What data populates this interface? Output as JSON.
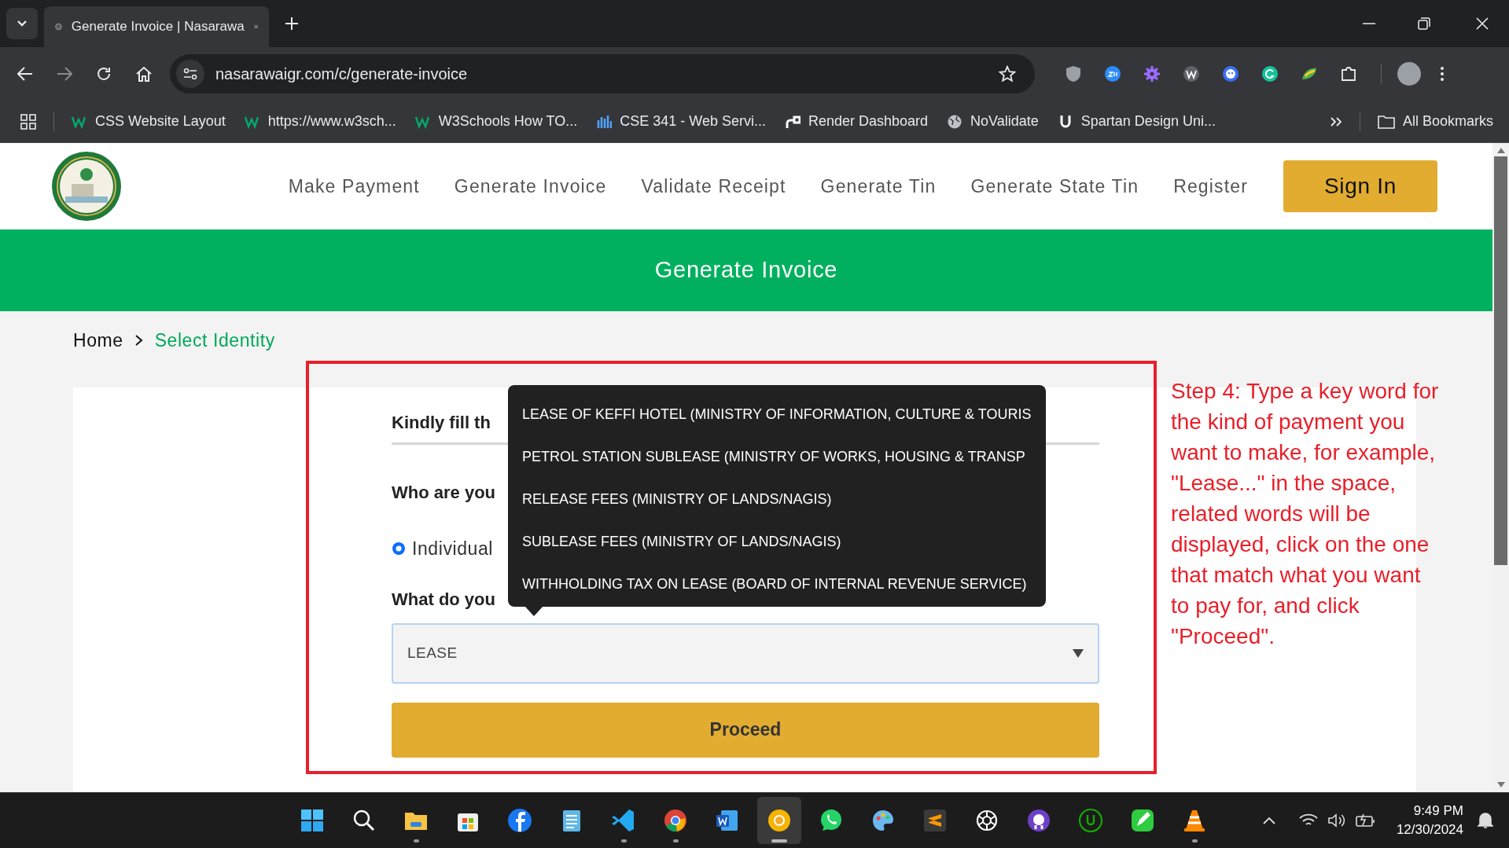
{
  "browser": {
    "tabs": [
      {
        "title": "Generate Invoice | Nasarawa",
        "selected": true
      }
    ],
    "url": "nasarawaigr.com/c/generate-invoice",
    "extensions": [
      {
        "kind": "shield"
      },
      {
        "kind": "zoom"
      },
      {
        "kind": "gear"
      },
      {
        "kind": "w"
      },
      {
        "kind": "face"
      },
      {
        "kind": "g"
      },
      {
        "kind": "leaf"
      },
      {
        "kind": "puzzle"
      }
    ],
    "bookmarks": [
      {
        "kind": "w3",
        "label": "CSS Website Layout"
      },
      {
        "kind": "w3",
        "label": "https://www.w3sch..."
      },
      {
        "kind": "w3",
        "label": "W3Schools How TO..."
      },
      {
        "kind": "bars",
        "label": "CSE 341 - Web Servi..."
      },
      {
        "kind": "render",
        "label": "Render Dashboard"
      },
      {
        "kind": "globe",
        "label": "NoValidate"
      },
      {
        "kind": "u",
        "label": "Spartan Design Uni..."
      }
    ],
    "all_bookmarks": "All Bookmarks"
  },
  "site": {
    "nav": [
      "Make Payment",
      "Generate Invoice",
      "Validate Receipt",
      "Generate Tin",
      "Generate State Tin",
      "Register"
    ],
    "sign_in": "Sign In",
    "banner_title": "Generate Invoice",
    "breadcrumb": [
      {
        "label": "Home",
        "current": false
      },
      {
        "label": "Select Identity",
        "current": true
      }
    ],
    "form": {
      "heading": "Kindly fill th",
      "who_label": "Who are you",
      "options": [
        {
          "label": "Individual",
          "selected": true
        }
      ],
      "what_label": "What do you",
      "select": {
        "value": "LEASE"
      },
      "suggestions": [
        "LEASE OF KEFFI HOTEL (MINISTRY OF INFORMATION, CULTURE & TOURIS",
        "PETROL STATION SUBLEASE (MINISTRY OF WORKS, HOUSING & TRANSP",
        "RELEASE FEES (MINISTRY OF LANDS/NAGIS)",
        "SUBLEASE FEES (MINISTRY OF LANDS/NAGIS)",
        "WITHHOLDING TAX ON LEASE (BOARD OF INTERNAL REVENUE SERVICE)"
      ],
      "proceed": "Proceed"
    }
  },
  "annotation": "Step 4: Type a key word for the kind of payment you want to make, for example, \"Lease...\" in the space, related words will be displayed, click on the one that match what you want to pay for, and click \"Proceed\".",
  "taskbar": {
    "apps": [
      {
        "kind": "start",
        "running": false,
        "active": false
      },
      {
        "kind": "search",
        "running": false,
        "active": false
      },
      {
        "kind": "folder",
        "running": true,
        "active": false
      },
      {
        "kind": "store",
        "running": false,
        "active": false
      },
      {
        "kind": "facebook",
        "running": false,
        "active": false
      },
      {
        "kind": "notepad",
        "running": false,
        "active": false
      },
      {
        "kind": "vscode",
        "running": true,
        "active": false
      },
      {
        "kind": "chrome",
        "running": true,
        "active": false
      },
      {
        "kind": "word",
        "running": false,
        "active": false
      },
      {
        "kind": "canary",
        "running": true,
        "active": true
      },
      {
        "kind": "whatsapp",
        "running": false,
        "active": false
      },
      {
        "kind": "paint",
        "running": false,
        "active": false
      },
      {
        "kind": "sublime",
        "running": false,
        "active": false
      },
      {
        "kind": "openai",
        "running": false,
        "active": false
      },
      {
        "kind": "github",
        "running": false,
        "active": false
      },
      {
        "kind": "upwork",
        "running": false,
        "active": false
      },
      {
        "kind": "pen",
        "running": false,
        "active": false
      },
      {
        "kind": "vlc",
        "running": true,
        "active": false
      }
    ],
    "time": "9:49 PM",
    "date": "12/30/2024"
  }
}
